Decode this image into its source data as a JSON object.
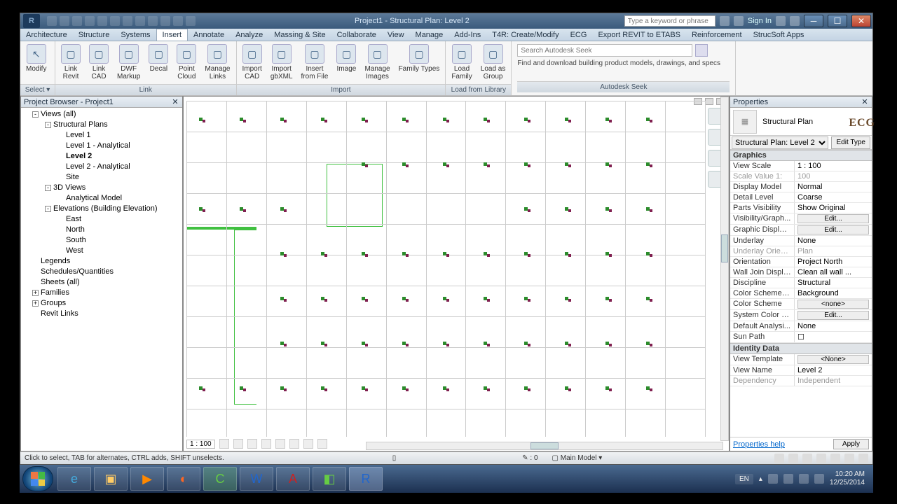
{
  "app": {
    "title": "Project1 - Structural Plan: Level 2",
    "search_placeholder": "Type a keyword or phrase",
    "sign_in": "Sign In"
  },
  "menus": [
    "Architecture",
    "Structure",
    "Systems",
    "Insert",
    "Annotate",
    "Analyze",
    "Massing & Site",
    "Collaborate",
    "View",
    "Manage",
    "Add-Ins",
    "T4R: Create/Modify",
    "ECG",
    "Export REVIT to ETABS",
    "Reinforcement",
    "StrucSoft Apps"
  ],
  "menu_active_index": 3,
  "ribbon": {
    "select": "Select ▾",
    "modify": "Modify",
    "panels": [
      {
        "title": "Link",
        "buttons": [
          "Link\nRevit",
          "Link\nCAD",
          "DWF\nMarkup",
          "Decal\n",
          "Point\nCloud",
          "Manage\nLinks"
        ]
      },
      {
        "title": "Import",
        "buttons": [
          "Import\nCAD",
          "Import\ngbXML",
          "Insert\nfrom File",
          "Image",
          "Manage\nImages",
          "Family Types"
        ]
      },
      {
        "title": "Load from Library",
        "buttons": [
          "Load\nFamily",
          "Load as\nGroup"
        ]
      }
    ],
    "seek": {
      "title": "Autodesk Seek",
      "placeholder": "Search Autodesk Seek",
      "desc": "Find and download building product models, drawings, and specs"
    }
  },
  "browser": {
    "title": "Project Browser - Project1",
    "tree": [
      {
        "ind": 0,
        "exp": "-",
        "label": "Views (all)"
      },
      {
        "ind": 1,
        "exp": "-",
        "label": "Structural Plans"
      },
      {
        "ind": 2,
        "label": "Level 1"
      },
      {
        "ind": 2,
        "label": "Level 1 - Analytical"
      },
      {
        "ind": 2,
        "label": "Level 2",
        "bold": true
      },
      {
        "ind": 2,
        "label": "Level 2 - Analytical"
      },
      {
        "ind": 2,
        "label": "Site"
      },
      {
        "ind": 1,
        "exp": "-",
        "label": "3D Views"
      },
      {
        "ind": 2,
        "label": "Analytical Model"
      },
      {
        "ind": 1,
        "exp": "-",
        "label": "Elevations (Building Elevation)"
      },
      {
        "ind": 2,
        "label": "East"
      },
      {
        "ind": 2,
        "label": "North"
      },
      {
        "ind": 2,
        "label": "South"
      },
      {
        "ind": 2,
        "label": "West"
      },
      {
        "ind": 0,
        "label": "Legends"
      },
      {
        "ind": 0,
        "label": "Schedules/Quantities"
      },
      {
        "ind": 0,
        "label": "Sheets (all)"
      },
      {
        "ind": 0,
        "exp": "+",
        "label": "Families"
      },
      {
        "ind": 0,
        "exp": "+",
        "label": "Groups"
      },
      {
        "ind": 0,
        "label": "Revit Links"
      }
    ]
  },
  "canvas": {
    "scale": "1 : 100",
    "workset": "Main Model"
  },
  "properties": {
    "title": "Properties",
    "type": "Structural Plan",
    "selector": "Structural Plan: Level 2",
    "edit_type": "Edit Type",
    "groups": [
      {
        "name": "Graphics",
        "rows": [
          {
            "k": "View Scale",
            "v": "1 : 100"
          },
          {
            "k": "Scale Value    1:",
            "v": "100",
            "dis": true
          },
          {
            "k": "Display Model",
            "v": "Normal"
          },
          {
            "k": "Detail Level",
            "v": "Coarse"
          },
          {
            "k": "Parts Visibility",
            "v": "Show Original"
          },
          {
            "k": "Visibility/Graph...",
            "v": "Edit...",
            "btn": true
          },
          {
            "k": "Graphic Display...",
            "v": "Edit...",
            "btn": true
          },
          {
            "k": "Underlay",
            "v": "None"
          },
          {
            "k": "Underlay Orient...",
            "v": "Plan",
            "dis": true
          },
          {
            "k": "Orientation",
            "v": "Project North"
          },
          {
            "k": "Wall Join Display",
            "v": "Clean all wall ..."
          },
          {
            "k": "Discipline",
            "v": "Structural"
          },
          {
            "k": "Color Scheme L...",
            "v": "Background"
          },
          {
            "k": "Color Scheme",
            "v": "<none>",
            "btn": true
          },
          {
            "k": "System Color S...",
            "v": "Edit...",
            "btn": true
          },
          {
            "k": "Default Analysi...",
            "v": "None"
          },
          {
            "k": "Sun Path",
            "v": "☐"
          }
        ]
      },
      {
        "name": "Identity Data",
        "rows": [
          {
            "k": "View Template",
            "v": "<None>",
            "btn": true
          },
          {
            "k": "View Name",
            "v": "Level 2"
          },
          {
            "k": "Dependency",
            "v": "Independent",
            "dis": true
          }
        ]
      }
    ],
    "help": "Properties help",
    "apply": "Apply"
  },
  "status": {
    "hint": "Click to select, TAB for alternates, CTRL adds, SHIFT unselects.",
    "zero": "0"
  },
  "taskbar": {
    "lang": "EN",
    "time": "10:20 AM",
    "date": "12/25/2014"
  },
  "branding": "ECG"
}
